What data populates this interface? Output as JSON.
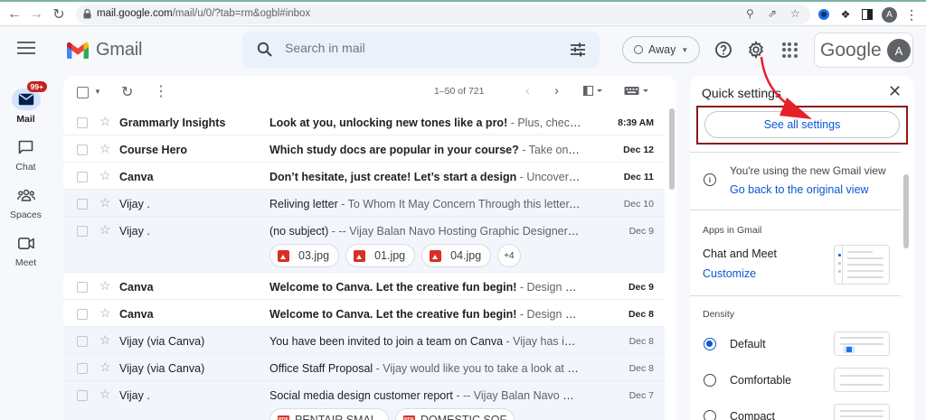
{
  "browser": {
    "url_host": "mail.google.com",
    "url_path": "/mail/u/0/?tab=rm&ogbl#inbox"
  },
  "header": {
    "logo_text": "Gmail",
    "search_placeholder": "Search in mail",
    "status_label": "Away",
    "account_brand": "Google",
    "avatar_letter": "A"
  },
  "rail": {
    "mail_badge": "99+",
    "items": [
      {
        "label": "Mail"
      },
      {
        "label": "Chat"
      },
      {
        "label": "Spaces"
      },
      {
        "label": "Meet"
      }
    ]
  },
  "toolbar": {
    "pager": "1–50 of 721"
  },
  "emails": [
    {
      "sender": "Grammarly Insights",
      "subject": "Look at you, unlocking new tones like a pro!",
      "snippet": " - Plus, check out...",
      "date": "8:39 AM",
      "unread": true
    },
    {
      "sender": "Course Hero",
      "subject": "Which study docs are popular in your course?",
      "snippet": " - Take one sim...",
      "date": "Dec 12",
      "unread": true
    },
    {
      "sender": "Canva",
      "subject": "Don’t hesitate, just create! Let’s start a design",
      "snippet": " - Uncover yo...",
      "date": "Dec 11",
      "unread": true
    },
    {
      "sender": "Vijay .",
      "subject": "Reliving letter",
      "snippet": " - To Whom It May Concern Through this letter, I ce...",
      "date": "Dec 10",
      "unread": false
    },
    {
      "sender": "Vijay .",
      "subject": "(no subject)",
      "snippet": " - -- Vijay Balan Navo Hosting Graphic Designer Add...",
      "date": "Dec 9",
      "unread": false,
      "attachments": [
        "03.jpg",
        "01.jpg",
        "04.jpg"
      ],
      "more": "+4"
    },
    {
      "sender": "Canva",
      "subject": "Welcome to Canva. Let the creative fun begin!",
      "snippet": " - Design anyt...",
      "date": "Dec 9",
      "unread": true
    },
    {
      "sender": "Canva",
      "subject": "Welcome to Canva. Let the creative fun begin!",
      "snippet": " - Design anyt...",
      "date": "Dec 8",
      "unread": true
    },
    {
      "sender": "Vijay (via Canva)",
      "subject": "You have been invited to join a team on Canva",
      "snippet": " - Vijay has invited ...",
      "date": "Dec 8",
      "unread": false
    },
    {
      "sender": "Vijay (via Canva)",
      "subject": "Office Staff Proposal",
      "snippet": " - Vijay would like you to take a look at the ...",
      "date": "Dec 8",
      "unread": false
    },
    {
      "sender": "Vijay .",
      "subject": "Social media design customer report",
      "snippet": " - -- Vijay Balan Navo Hosti...",
      "date": "Dec 7",
      "unread": false,
      "pdf_attachments": [
        "PENTAIR SMAL...",
        "DOMESTIC SOF..."
      ]
    }
  ],
  "quick_settings": {
    "title": "Quick settings",
    "see_all": "See all settings",
    "new_view": "You're using the new Gmail view",
    "go_back": "Go back to the original view",
    "apps_title": "Apps in Gmail",
    "chat_meet": "Chat and Meet",
    "customize": "Customize",
    "density_title": "Density",
    "density_options": [
      "Default",
      "Comfortable",
      "Compact"
    ],
    "density_selected": "Default"
  },
  "colors": {
    "accent_blue": "#0b57d0",
    "badge_red": "#c5221f",
    "highlight_box": "#8b1a1a",
    "arrow_red": "#e8202a"
  }
}
